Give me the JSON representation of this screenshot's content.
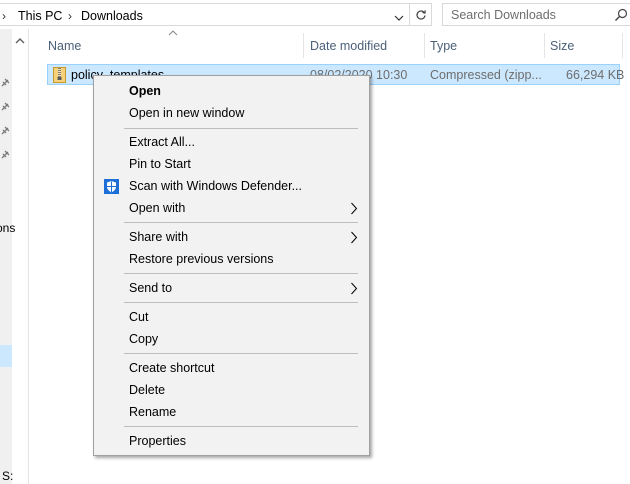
{
  "address_bar": {
    "crumbs": [
      "This PC",
      "Downloads"
    ],
    "search_placeholder": "Search Downloads"
  },
  "nav": {
    "partial_labels": [
      "ons",
      "S:"
    ]
  },
  "columns": {
    "name": "Name",
    "date": "Date modified",
    "type": "Type",
    "size": "Size"
  },
  "file": {
    "name": "policy_templates",
    "date": "08/02/2020 10:30",
    "type": "Compressed (zipp...",
    "size": "66,294 KB"
  },
  "context_menu": {
    "items": [
      {
        "label": "Open"
      },
      {
        "label": "Open in new window"
      },
      {
        "label": "Extract All..."
      },
      {
        "label": "Pin to Start"
      },
      {
        "label": "Scan with Windows Defender..."
      },
      {
        "label": "Open with"
      },
      {
        "label": "Share with"
      },
      {
        "label": "Restore previous versions"
      },
      {
        "label": "Send to"
      },
      {
        "label": "Cut"
      },
      {
        "label": "Copy"
      },
      {
        "label": "Create shortcut"
      },
      {
        "label": "Delete"
      },
      {
        "label": "Rename"
      },
      {
        "label": "Properties"
      }
    ]
  },
  "colors": {
    "selection": "#cce8ff",
    "selection_border": "#99d1ff",
    "menu_bg": "#f2f2f2",
    "header_text": "#4c607a",
    "defender_blue": "#1e6ed8"
  }
}
